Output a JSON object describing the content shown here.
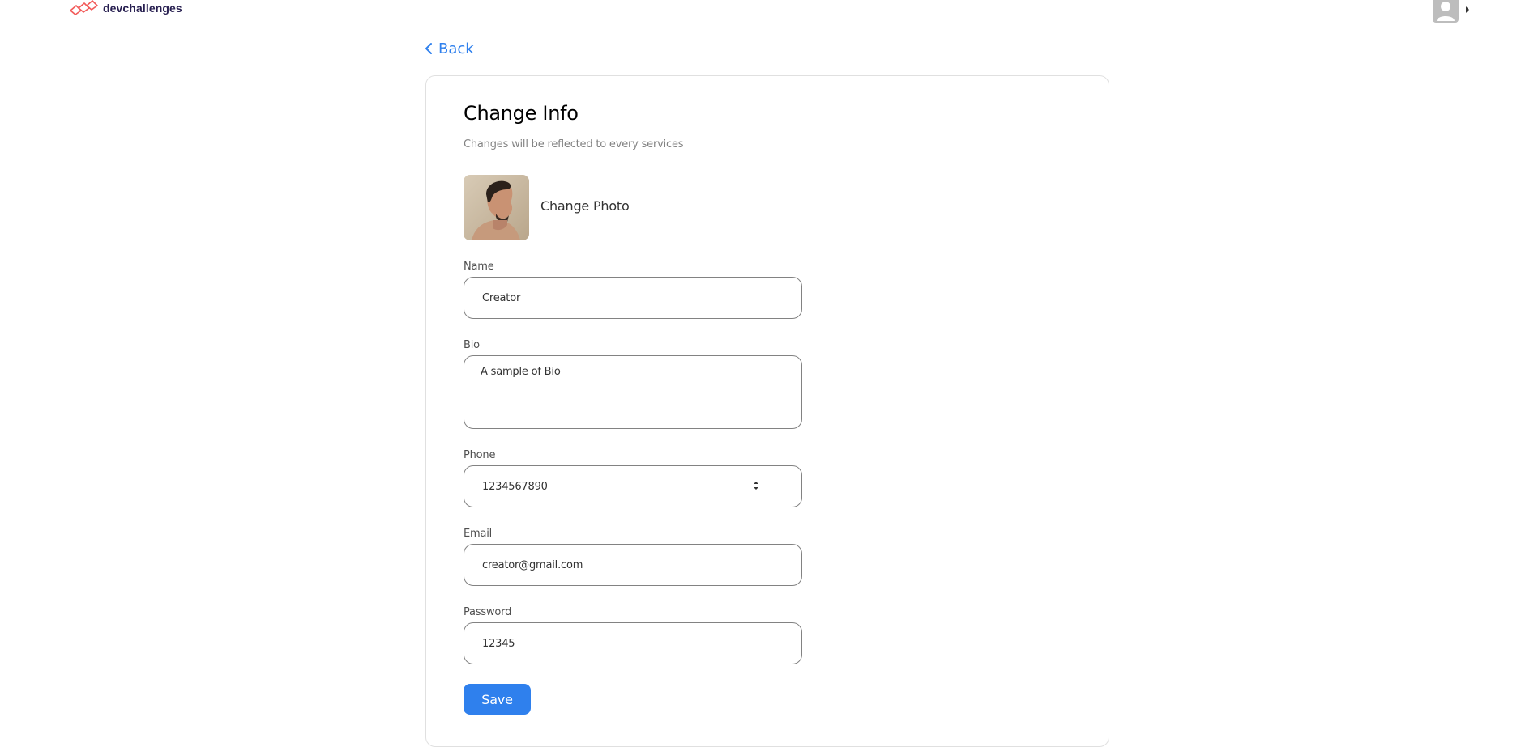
{
  "header": {
    "logo_text": "devchallenges",
    "avatar_icon": "user-icon",
    "menu_icon": "caret-right-icon"
  },
  "nav": {
    "back_label": "Back",
    "back_icon": "chevron-left-icon"
  },
  "form": {
    "title": "Change Info",
    "subtitle": "Changes will be reflected to every services",
    "change_photo_label": "Change Photo",
    "fields": {
      "name": {
        "label": "Name",
        "value": "Creator"
      },
      "bio": {
        "label": "Bio",
        "value": "A sample of Bio"
      },
      "phone": {
        "label": "Phone",
        "value": "1234567890"
      },
      "email": {
        "label": "Email",
        "value": "creator@gmail.com"
      },
      "password": {
        "label": "Password",
        "value": "12345"
      }
    },
    "save_label": "Save"
  },
  "colors": {
    "accent": "#2f80ed",
    "logo_red": "#f25a59",
    "logo_text": "#282051",
    "border": "#828282"
  }
}
